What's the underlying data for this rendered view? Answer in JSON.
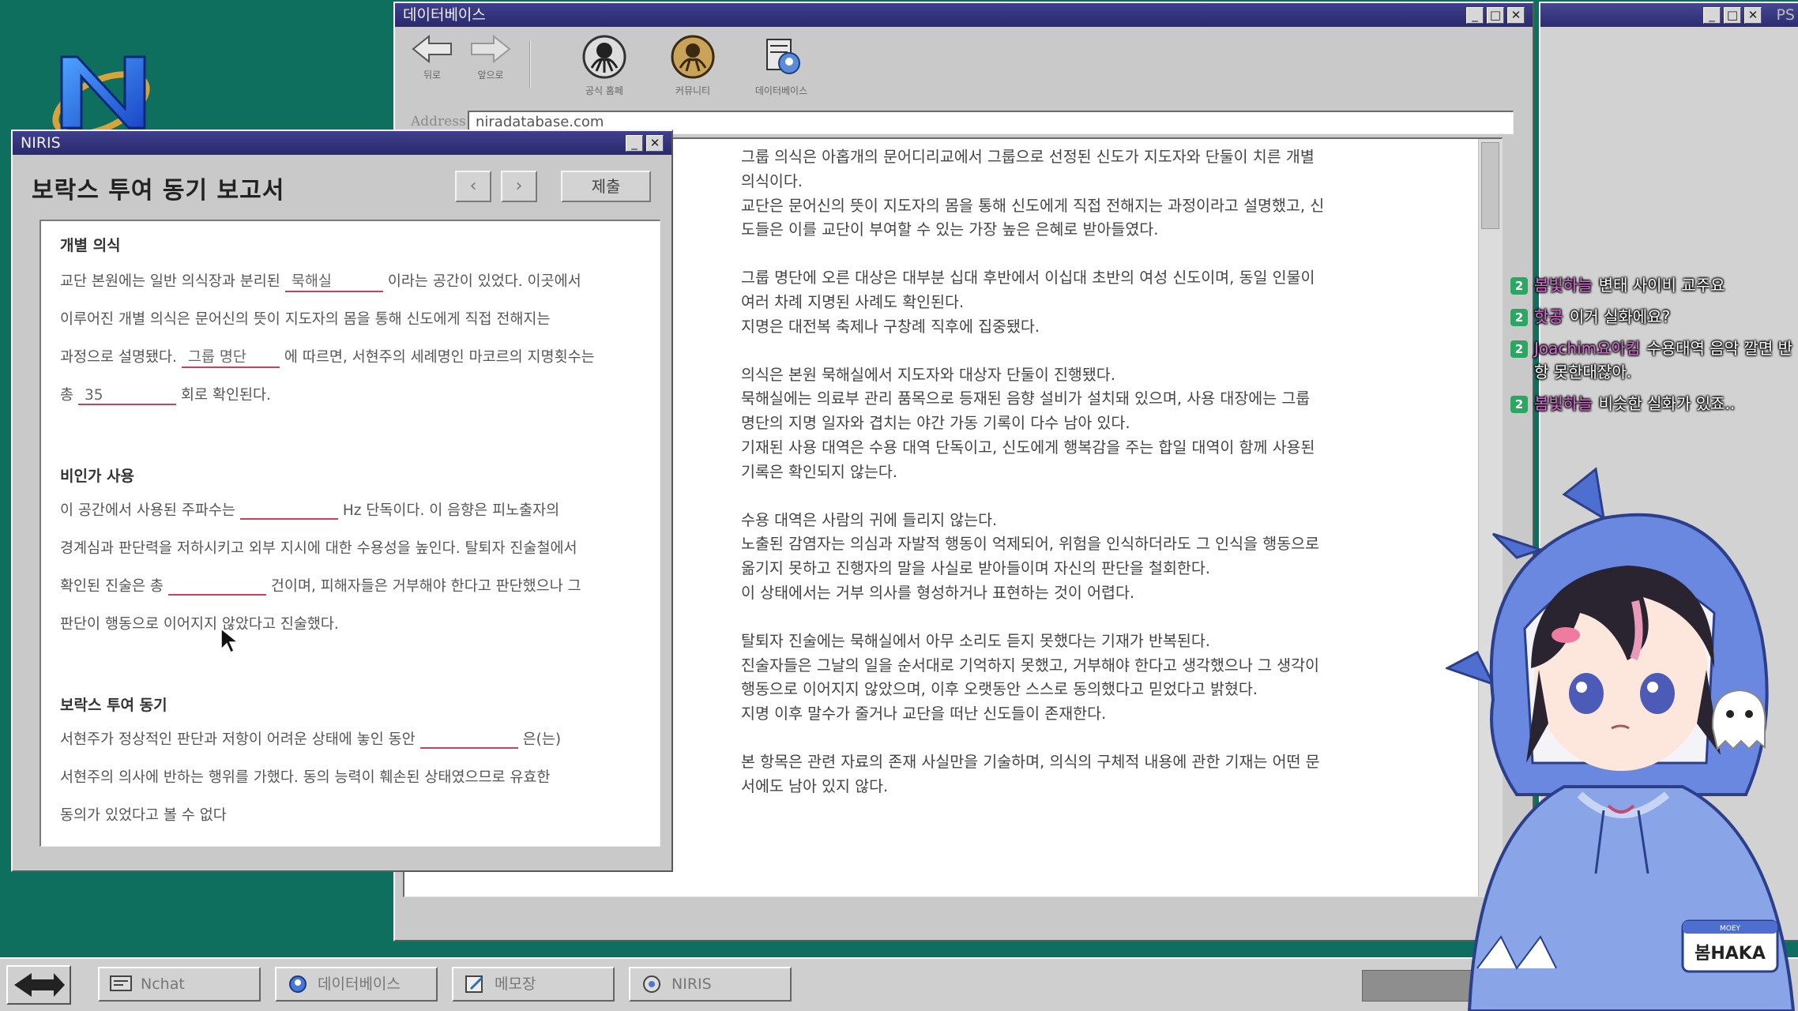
{
  "desktop": {
    "logo_letter": "N"
  },
  "db_window": {
    "title": "데이터베이스",
    "toolbar": {
      "back": "뒤로",
      "forward": "앞으로",
      "tool1": "공식 홈페",
      "tool2": "커뮤니티",
      "tool3": "데이터베이스"
    },
    "address_label": "Address",
    "address_value": "niradatabase.com",
    "paragraphs": [
      "그룹 의식은 아홉개의 문어디리교에서 그룹으로 선정된 신도가 지도자와 단둘이 치른 개별\n의식이다.\n교단은 문어신의 뜻이 지도자의 몸을 통해 신도에게 직접 전해지는 과정이라고 설명했고, 신\n도들은 이를 교단이 부여할 수 있는 가장 높은 은혜로 받아들였다.",
      "그룹 명단에 오른 대상은 대부분 십대 후반에서 이십대 초반의 여성 신도이며, 동일 인물이\n여러 차례 지명된 사례도 확인된다.\n지명은 대전복 축제나 구창례 직후에 집중됐다.",
      "의식은 본원 묵해실에서 지도자와 대상자 단둘이 진행됐다.\n묵해실에는 의료부 관리 품목으로 등재된 음향 설비가 설치돼 있으며, 사용 대장에는 그룹\n명단의 지명 일자와 겹치는 야간 가동 기록이 다수 남아 있다.\n기재된 사용 대역은 수용 대역 단독이고, 신도에게 행복감을 주는 합일 대역이 함께 사용된\n기록은 확인되지 않는다.",
      "수용 대역은 사람의 귀에 들리지 않는다.\n노출된 감염자는 의심과 자발적 행동이 억제되어, 위험을 인식하더라도 그 인식을 행동으로\n옮기지 못하고 진행자의 말을 사실로 받아들이며 자신의 판단을 철회한다.\n이 상태에서는 거부 의사를 형성하거나 표현하는 것이 어렵다.",
      "탈퇴자 진술에는 묵해실에서 아무 소리도 듣지 못했다는 기재가 반복된다.\n진술자들은 그날의 일을 순서대로 기억하지 못했고, 거부해야 한다고 생각했으나 그 생각이\n행동으로 이어지지 않았으며, 이후 오랫동안 스스로 동의했다고 믿었다고 밝혔다.\n지명 이후 말수가 줄거나 교단을 떠난 신도들이 존재한다.",
      "본 항목은 관련 자료의 존재 사실만을 기술하며, 의식의 구체적 내용에 관한 기재는 어떤 문\n서에도 남아 있지 않다."
    ]
  },
  "right_window": {
    "title": "PS"
  },
  "niris": {
    "title": "NIRIS",
    "header": "보락스 투여 동기 보고서",
    "prev": "‹",
    "next": "›",
    "submit": "제출",
    "s1_title": "개별 의식",
    "s1_l1a": "교단 본원에는 일반 의식장과 분리된",
    "s1_b1": "묵해실",
    "s1_l1b": "이라는 공간이 있었다. 이곳에서",
    "s1_l2": "이루어진 개별 의식은 문어신의 뜻이 지도자의 몸을 통해 신도에게 직접 전해지는",
    "s1_l3a": "과정으로 설명됐다.",
    "s1_b2": "그룹 명단",
    "s1_l3b": "에 따르면, 서현주의 세례명인 마코르의 지명횟수는",
    "s1_l4a": "총",
    "s1_b3": "35",
    "s1_l4b": "회로 확인된다.",
    "s2_title": "비인가 사용",
    "s2_l1a": "이 공간에서 사용된 주파수는",
    "s2_b1": "",
    "s2_l1b": "Hz 단독이다. 이 음향은 피노출자의",
    "s2_l2": "경계심과 판단력을 저하시키고 외부 지시에 대한 수용성을 높인다. 탈퇴자 진술철에서",
    "s2_l3a": "확인된 진술은 총",
    "s2_b2": "",
    "s2_l3b": "건이며, 피해자들은 거부해야 한다고 판단했으나 그",
    "s2_l4": "판단이 행동으로 이어지지 않았다고 진술했다.",
    "s3_title": "보락스 투여 동기",
    "s3_l1a": "서현주가 정상적인 판단과 저항이 어려운 상태에 놓인 동안",
    "s3_b1": "",
    "s3_l1b": "은(는)",
    "s3_l2": "서현주의 의사에 반하는 행위를 가했다. 동의 능력이 훼손된 상태였으므로 유효한",
    "s3_l3": "동의가 있었다고 볼 수 없다"
  },
  "chat": [
    {
      "badge": "2",
      "name": "봄빛하늘",
      "text": "변태 사이비 교주요"
    },
    {
      "badge": "2",
      "name": "핫공",
      "text": "이거 실화에요?"
    },
    {
      "badge": "2",
      "name": "Joachim요아킴",
      "text": "수용대역 음악 깔면 반항 못한대잖아."
    },
    {
      "badge": "2",
      "name": "봄빛하늘",
      "text": "비슷한 실화가 있죠.."
    }
  ],
  "avatar": {
    "name_tag": "봄HAKA",
    "tag_top": "MOEY"
  },
  "taskbar": {
    "items": [
      "Nchat",
      "데이터베이스",
      "메모장",
      "NIRIS"
    ]
  },
  "colors": {
    "desktop": "#0e6f5e",
    "titlebar": "#2a2a70",
    "blank_underline": "#c4455b",
    "chat_name": "#d86ad6",
    "chat_badge": "#2aa760"
  }
}
